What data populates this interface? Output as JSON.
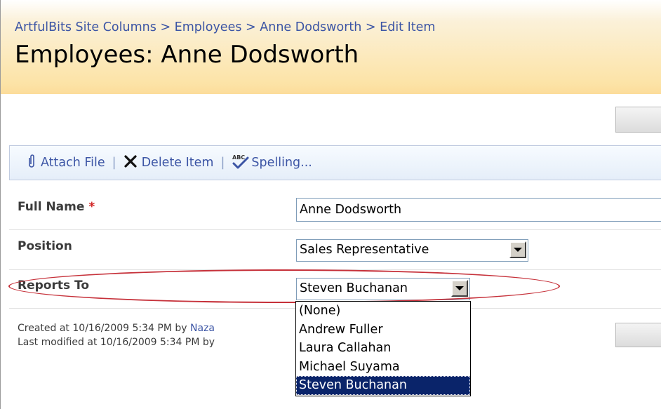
{
  "breadcrumb": {
    "items": [
      "ArtfulBits Site Columns",
      "Employees",
      "Anne Dodsworth",
      "Edit Item"
    ],
    "separator": ">"
  },
  "page_title": "Employees: Anne Dodsworth",
  "toolbar": {
    "attach_label": "Attach File",
    "delete_label": "Delete Item",
    "spelling_label": "Spelling...",
    "separator": "|",
    "attach_icon": "paperclip-icon",
    "delete_icon": "delete-x-icon",
    "spelling_icon": "spellcheck-icon"
  },
  "form": {
    "full_name_label": "Full Name",
    "required_marker": "*",
    "full_name_value": "Anne Dodsworth",
    "position_label": "Position",
    "position_value": "Sales Representative",
    "reports_to_label": "Reports To",
    "reports_to_value": "Steven Buchanan",
    "reports_to_options": [
      "(None)",
      "Andrew Fuller",
      "Laura Callahan",
      "Michael Suyama",
      "Steven Buchanan"
    ],
    "reports_to_selected_index": 4
  },
  "meta": {
    "created_prefix": "Created at 10/16/2009 5:34 PM  by ",
    "created_by": "Naza",
    "modified_prefix": "Last modified at 10/16/2009 5:34 PM  by"
  },
  "colors": {
    "header_gradient_end": "#fcdc9a",
    "link": "#3c55a5",
    "highlight_ellipse": "#c6313a",
    "selected_option_bg": "#0a246a"
  }
}
